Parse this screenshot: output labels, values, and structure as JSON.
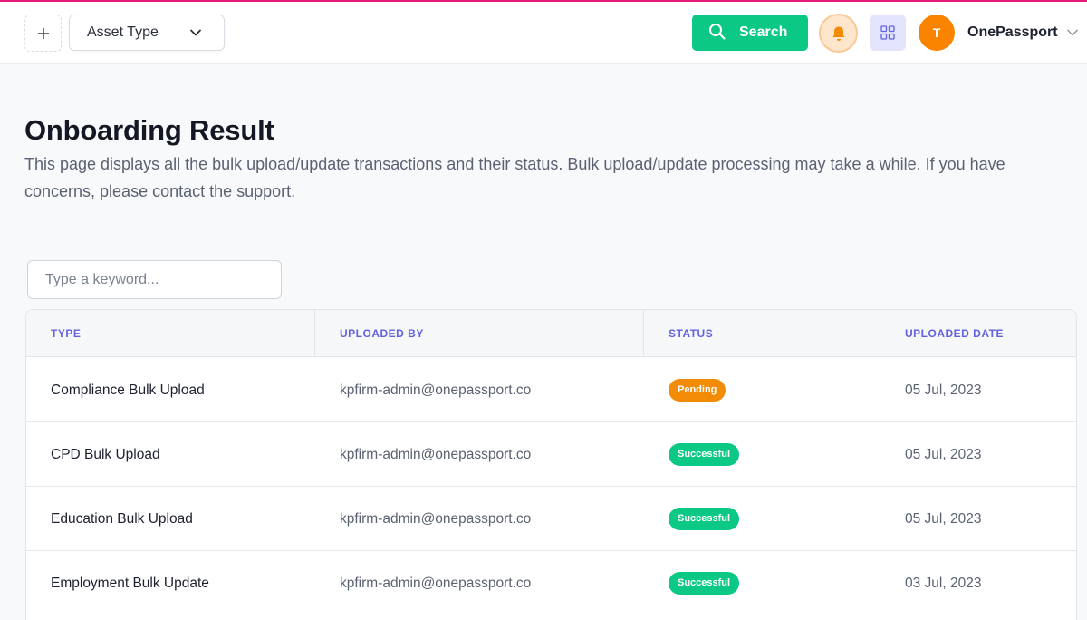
{
  "header": {
    "asset_type_label": "Asset Type",
    "search_label": "Search",
    "avatar_initial": "T",
    "user_name": "OnePassport",
    "colors": {
      "search": "#0bc985",
      "bell_bg": "#fde6cc",
      "avatar": "#fa8400",
      "accent_line": "#e5197a"
    }
  },
  "page": {
    "title": "Onboarding Result",
    "description": "This page displays all the bulk upload/update transactions and their status. Bulk upload/update processing may take a while. If you have concerns, please contact the support."
  },
  "filter": {
    "placeholder": "Type a keyword..."
  },
  "table": {
    "columns": [
      "TYPE",
      "UPLOADED BY",
      "STATUS",
      "UPLOADED DATE"
    ],
    "rows": [
      {
        "type": "Compliance Bulk Upload",
        "uploaded_by": "kpfirm-admin@onepassport.co",
        "status": "Pending",
        "status_color": "#f28c06",
        "date": "05 Jul, 2023"
      },
      {
        "type": "CPD Bulk Upload",
        "uploaded_by": "kpfirm-admin@onepassport.co",
        "status": "Successful",
        "status_color": "#0bc985",
        "date": "05 Jul, 2023"
      },
      {
        "type": "Education Bulk Upload",
        "uploaded_by": "kpfirm-admin@onepassport.co",
        "status": "Successful",
        "status_color": "#0bc985",
        "date": "05 Jul, 2023"
      },
      {
        "type": "Employment Bulk Update",
        "uploaded_by": "kpfirm-admin@onepassport.co",
        "status": "Successful",
        "status_color": "#0bc985",
        "date": "03 Jul, 2023"
      }
    ]
  }
}
